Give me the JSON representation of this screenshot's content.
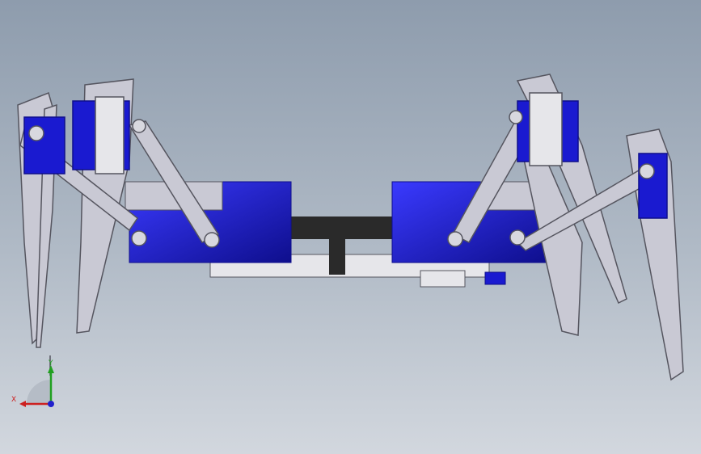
{
  "viewport": {
    "background_top": "#8e9cad",
    "background_bottom": "#d2d7de"
  },
  "model": {
    "icon": "hexapod-robot-assembly",
    "colors": {
      "servo": "#1a1ad0",
      "servo_dark": "#0e0e8c",
      "bracket": "#c9c9d4",
      "bracket_edge": "#55555f",
      "frame_dark": "#2a2a2a",
      "plate": "#e6e6ea"
    }
  },
  "triad": {
    "x_label": "X",
    "y_label": "Y",
    "x_color": "#cc2020",
    "y_color": "#20a020",
    "z_color": "#2020cc"
  }
}
